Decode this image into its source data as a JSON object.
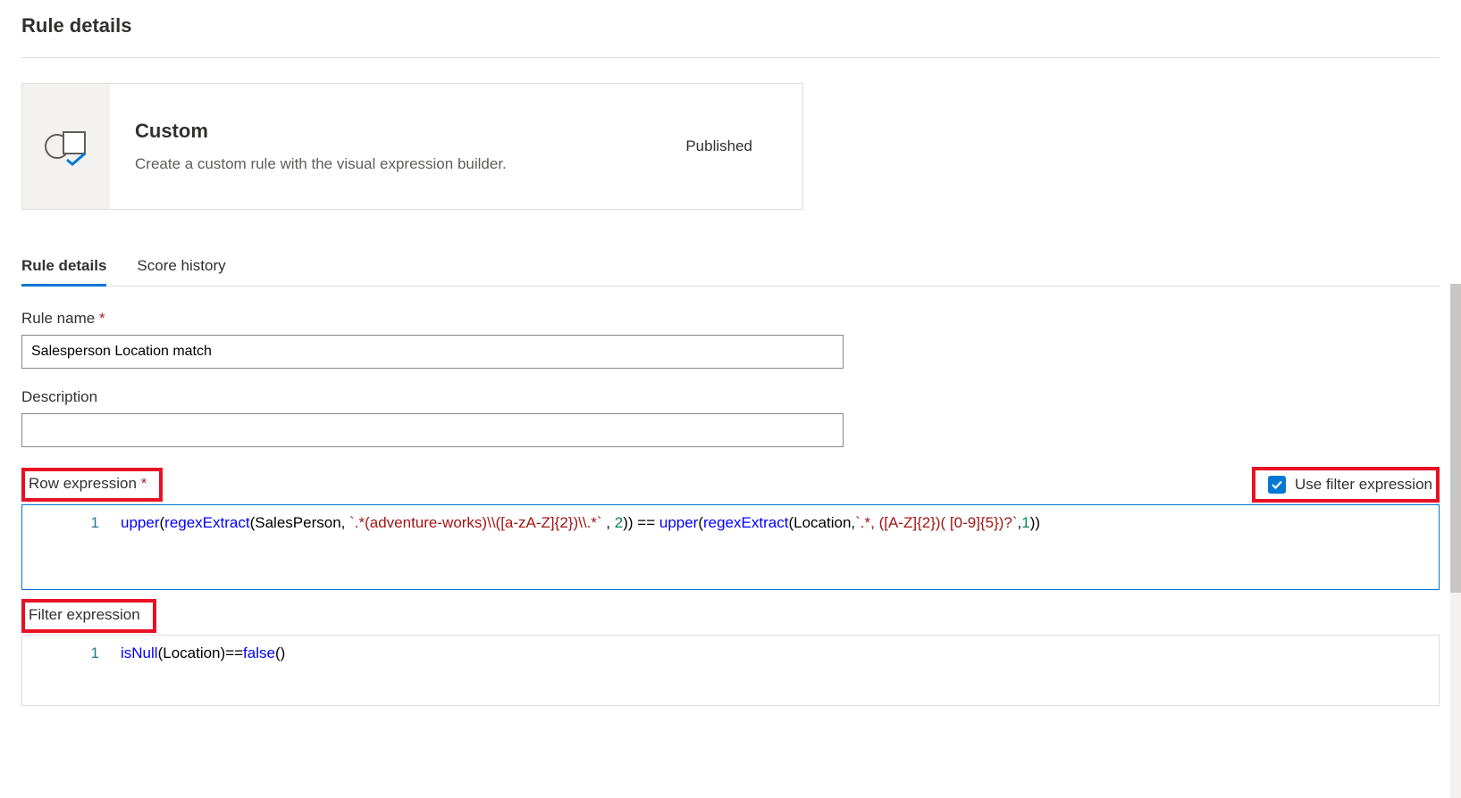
{
  "page": {
    "title": "Rule details"
  },
  "card": {
    "title": "Custom",
    "description": "Create a custom rule with the visual expression builder.",
    "status": "Published"
  },
  "tabs": [
    {
      "label": "Rule details",
      "active": true
    },
    {
      "label": "Score history",
      "active": false
    }
  ],
  "fields": {
    "ruleName": {
      "label": "Rule name",
      "required": true,
      "value": "Salesperson Location match"
    },
    "description": {
      "label": "Description",
      "required": false,
      "value": ""
    },
    "rowExpression": {
      "label": "Row expression",
      "required": true
    },
    "filterExpression": {
      "label": "Filter expression",
      "required": false
    },
    "useFilter": {
      "label": "Use filter expression",
      "checked": true
    }
  },
  "code": {
    "rowExpression": {
      "lineNumbers": [
        "1"
      ],
      "tokens": [
        {
          "t": "fn",
          "v": "upper"
        },
        {
          "t": "paren",
          "v": "("
        },
        {
          "t": "fn",
          "v": "regexExtract"
        },
        {
          "t": "paren",
          "v": "("
        },
        {
          "t": "plain",
          "v": "SalesPerson, "
        },
        {
          "t": "str",
          "v": "`.*(adventure-works)\\\\([a-zA-Z]{2})\\\\.*`"
        },
        {
          "t": "plain",
          "v": " , "
        },
        {
          "t": "num",
          "v": "2"
        },
        {
          "t": "paren",
          "v": "))"
        },
        {
          "t": "plain",
          "v": " == "
        },
        {
          "t": "fn",
          "v": "upper"
        },
        {
          "t": "paren",
          "v": "("
        },
        {
          "t": "fn",
          "v": "regexExtract"
        },
        {
          "t": "paren",
          "v": "("
        },
        {
          "t": "plain",
          "v": "Location,"
        },
        {
          "t": "str",
          "v": "`.*, ([A-Z]{2})( [0-9]{5})?`"
        },
        {
          "t": "plain",
          "v": ","
        },
        {
          "t": "num",
          "v": "1"
        },
        {
          "t": "paren",
          "v": "))"
        }
      ]
    },
    "filterExpression": {
      "lineNumbers": [
        "1"
      ],
      "tokens": [
        {
          "t": "fn",
          "v": "isNull"
        },
        {
          "t": "paren",
          "v": "("
        },
        {
          "t": "plain",
          "v": "Location"
        },
        {
          "t": "paren",
          "v": ")"
        },
        {
          "t": "plain",
          "v": "=="
        },
        {
          "t": "kw",
          "v": "false"
        },
        {
          "t": "paren",
          "v": "()"
        }
      ]
    }
  }
}
